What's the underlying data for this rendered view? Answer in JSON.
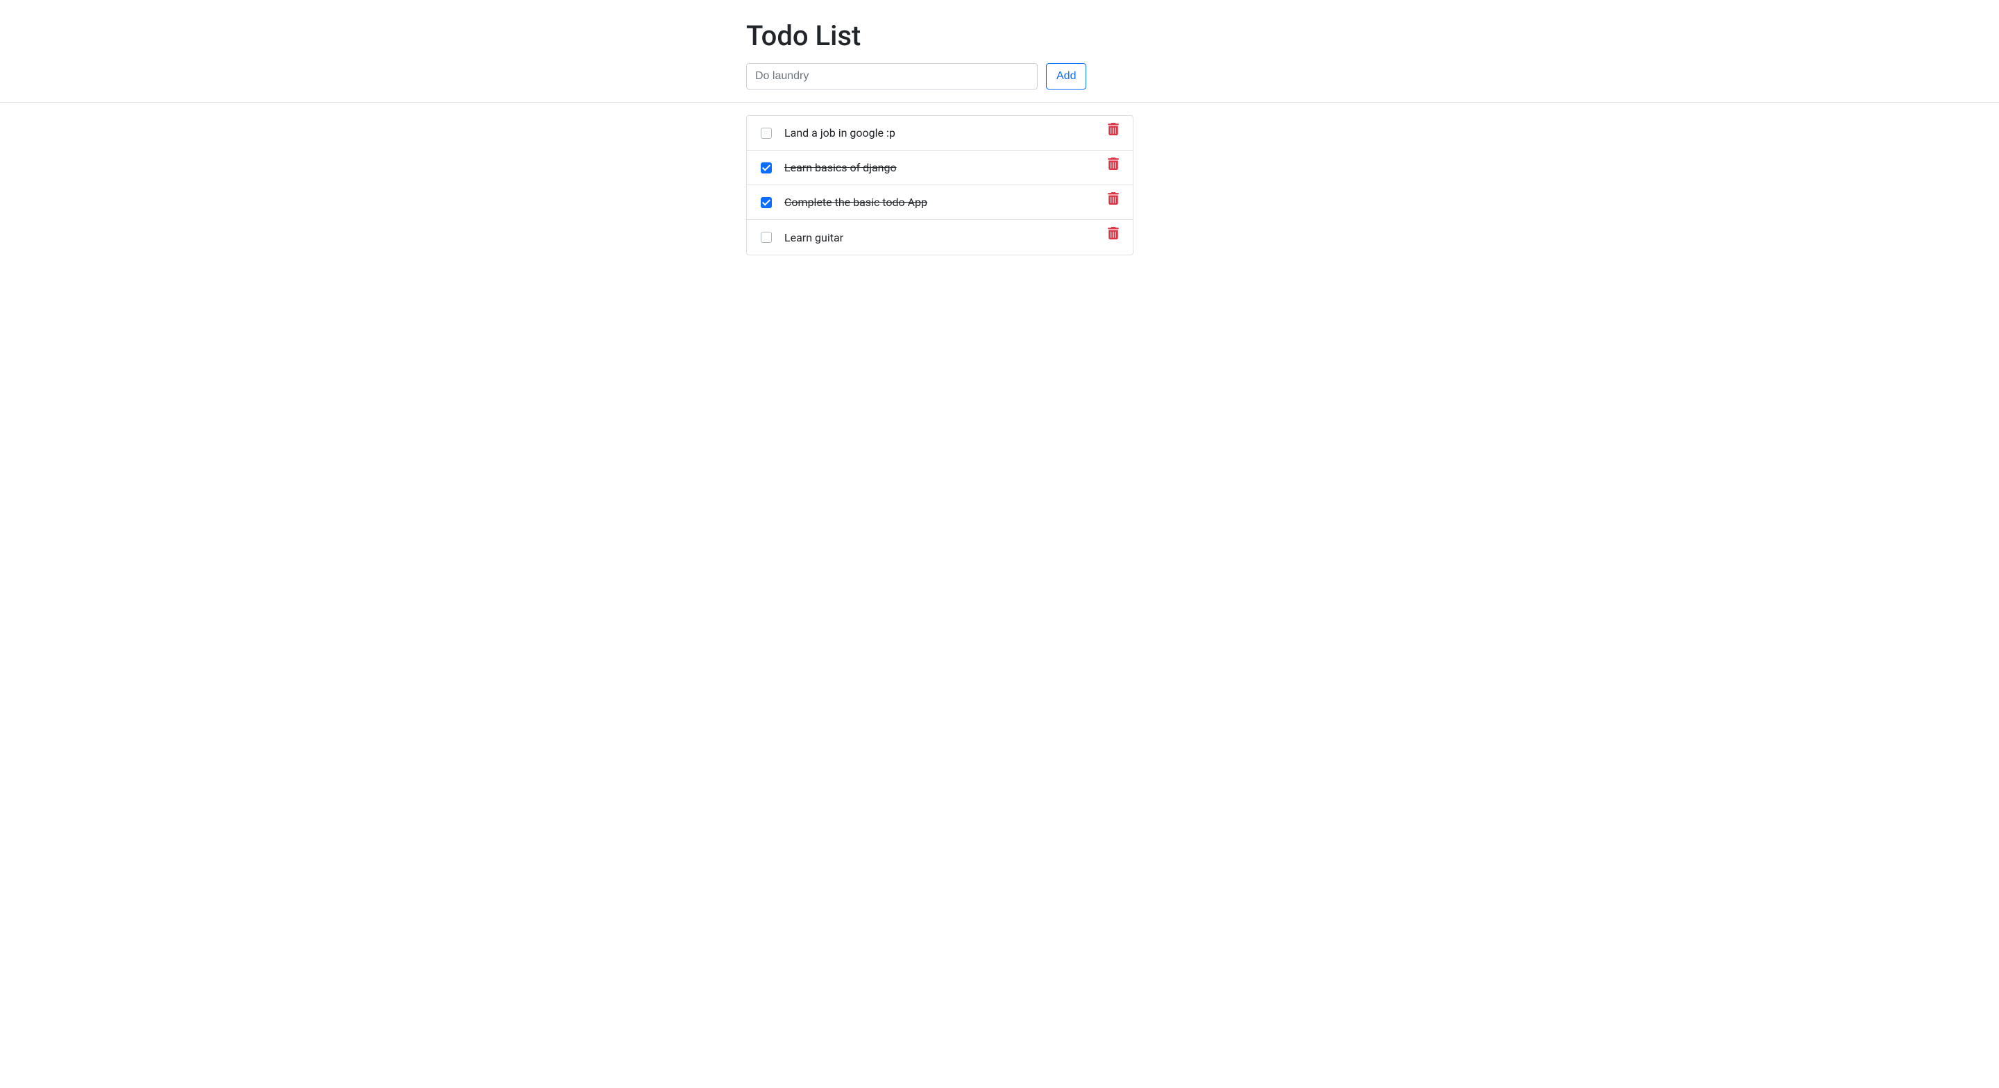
{
  "header": {
    "title": "Todo List"
  },
  "input": {
    "placeholder": "Do laundry",
    "value": ""
  },
  "buttons": {
    "add": "Add"
  },
  "todos": [
    {
      "label": "Land a job in google :p",
      "completed": false
    },
    {
      "label": "Learn basics of django",
      "completed": true
    },
    {
      "label": "Complete the basic todo App",
      "completed": true
    },
    {
      "label": "Learn guitar",
      "completed": false
    }
  ]
}
